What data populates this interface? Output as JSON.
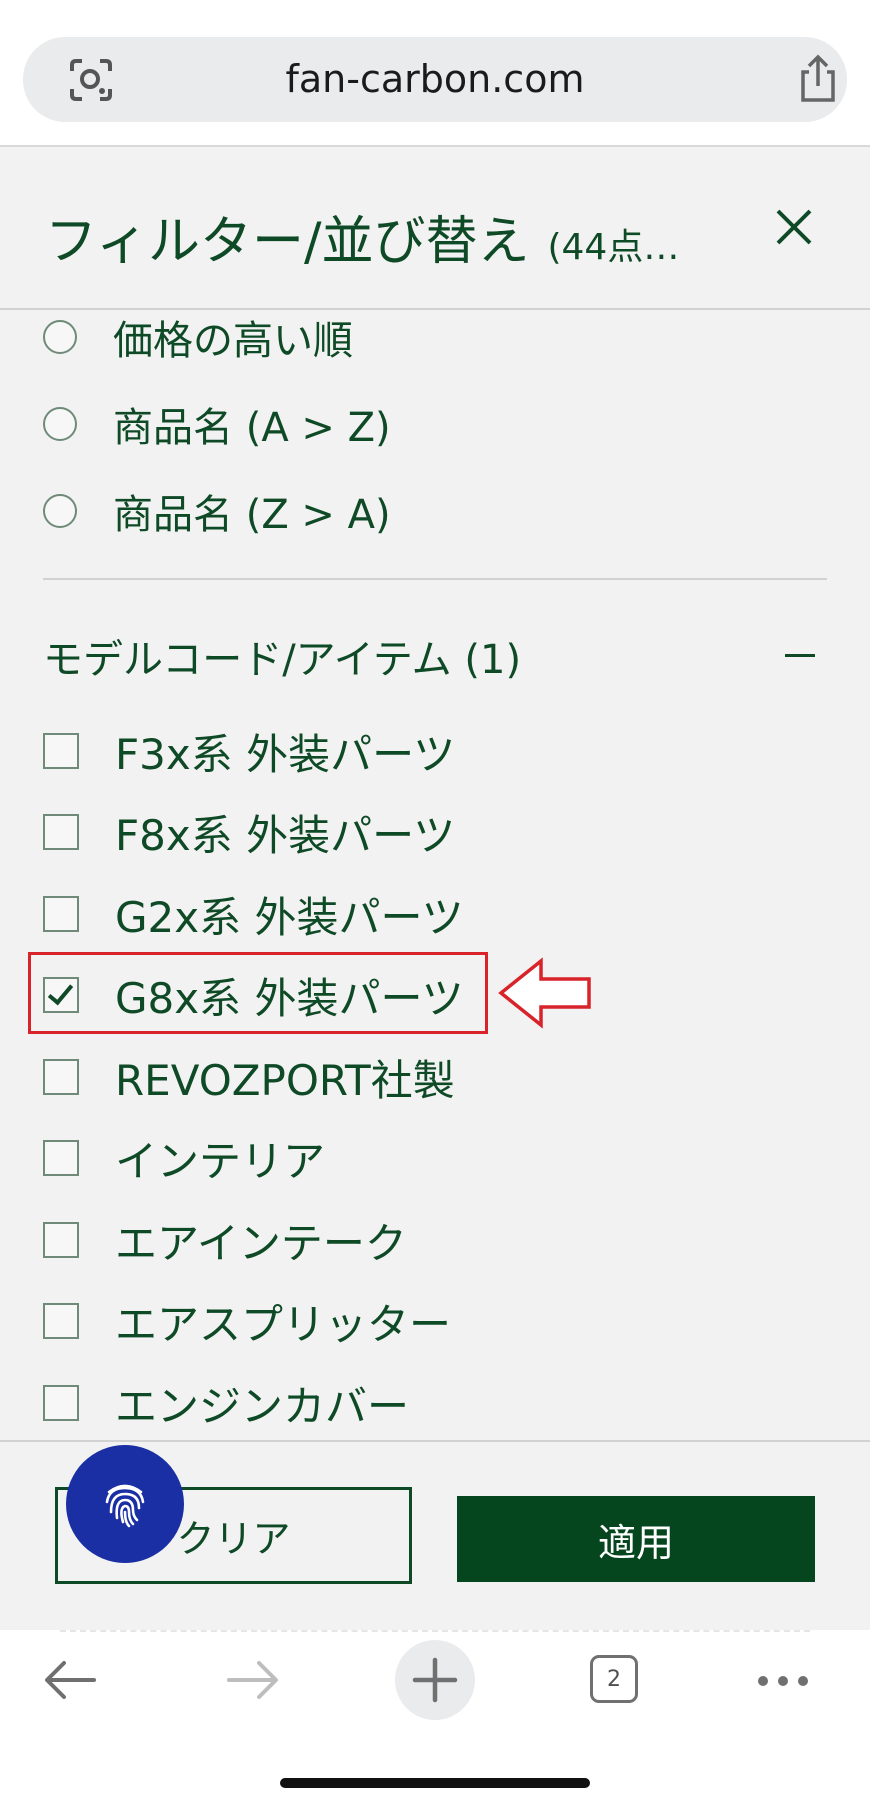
{
  "browser": {
    "url": "fan-carbon.com",
    "tab_count": "2"
  },
  "header": {
    "title": "フィルター/並び替え",
    "count": "(44点…",
    "close_icon": "close-icon"
  },
  "sort": {
    "options": [
      {
        "label": "価格の高い順",
        "selected": false
      },
      {
        "label": "商品名 (A > Z)",
        "selected": false
      },
      {
        "label": "商品名 (Z > A)",
        "selected": false
      }
    ]
  },
  "model_filter": {
    "title": "モデルコード/アイテム (1)",
    "items": [
      {
        "label": "F3x系 外装パーツ",
        "checked": false
      },
      {
        "label": "F8x系 外装パーツ",
        "checked": false
      },
      {
        "label": "G2x系 外装パーツ",
        "checked": false
      },
      {
        "label": "G8x系 外装パーツ",
        "checked": true
      },
      {
        "label": "REVOZPORT社製",
        "checked": false
      },
      {
        "label": "インテリア",
        "checked": false
      },
      {
        "label": "エアインテーク",
        "checked": false
      },
      {
        "label": "エアスプリッター",
        "checked": false
      },
      {
        "label": "エンジンカバー",
        "checked": false
      }
    ]
  },
  "footer": {
    "clear_label": "クリア",
    "apply_label": "適用"
  },
  "colors": {
    "brand_green": "#05461f",
    "highlight_red": "#d8232a",
    "fab_blue": "#1a2fa3"
  }
}
